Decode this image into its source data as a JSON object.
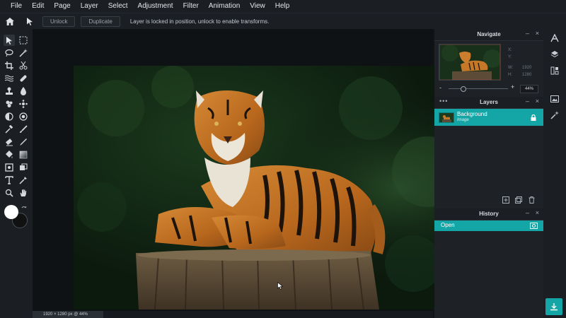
{
  "menu": [
    "File",
    "Edit",
    "Page",
    "Layer",
    "Select",
    "Adjustment",
    "Filter",
    "Animation",
    "View",
    "Help"
  ],
  "options_bar": {
    "unlock_label": "Unlock",
    "duplicate_label": "Duplicate",
    "message": "Layer is locked in position, unlock to enable transforms."
  },
  "status": {
    "info": "1920 × 1280 px @ 44%"
  },
  "navigate": {
    "title": "Navigate",
    "x_label": "X:",
    "y_label": "Y:",
    "w_label": "W:",
    "w_value": "1920",
    "h_label": "H:",
    "h_value": "1280",
    "zoom_minus": "-",
    "zoom_plus": "+",
    "zoom_value": "44%",
    "zoom_level": 0.25
  },
  "layers": {
    "title": "Layers",
    "items": [
      {
        "name": "Background",
        "type": "Image"
      }
    ]
  },
  "history": {
    "title": "History",
    "items": [
      {
        "name": "Open"
      }
    ]
  },
  "colors": {
    "accent": "#14a6a6",
    "primary": "#ffffff",
    "secondary": "#111111"
  }
}
